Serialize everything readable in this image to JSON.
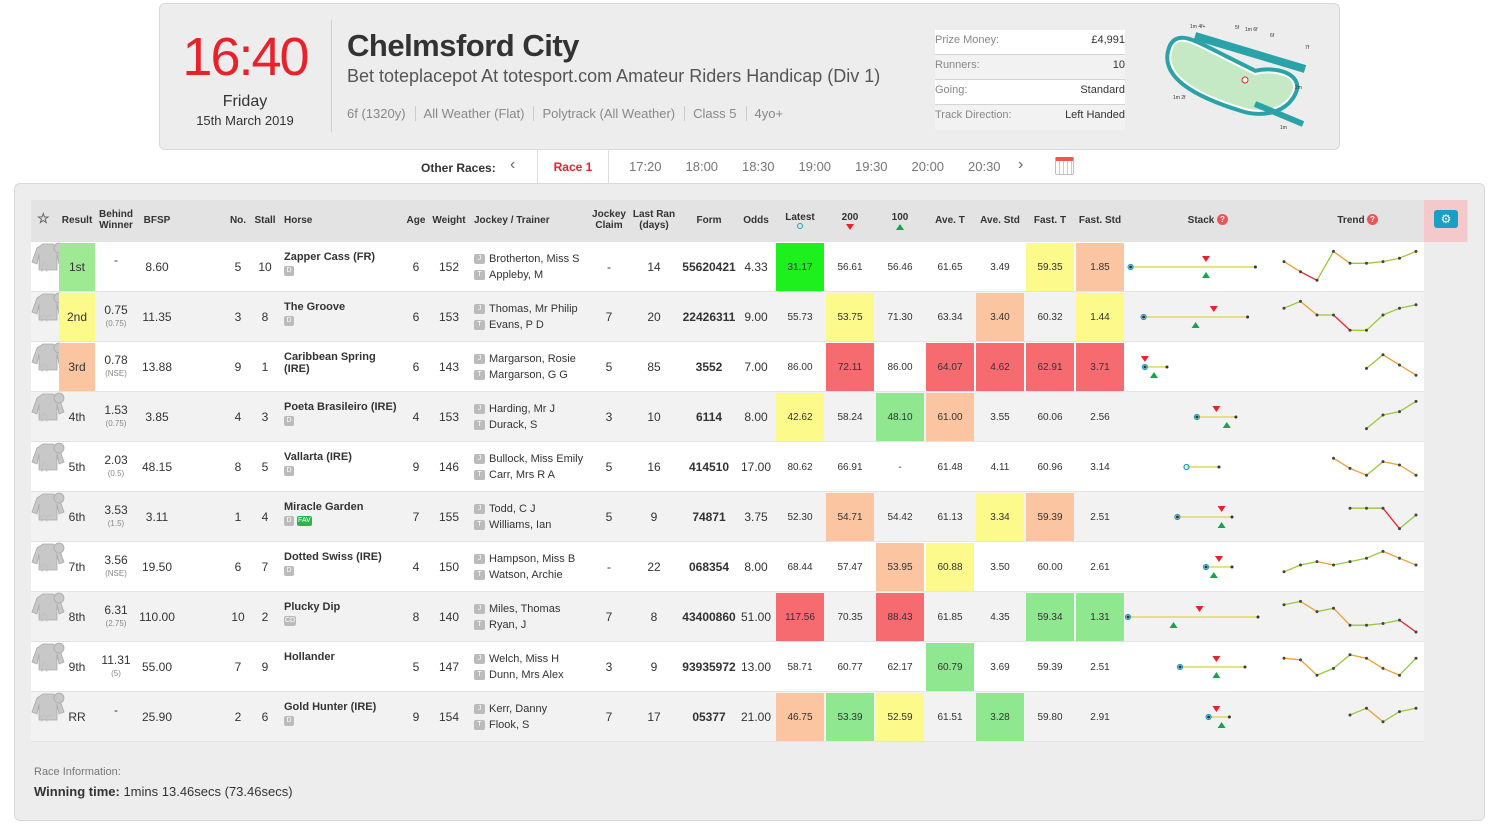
{
  "header": {
    "time": "16:40",
    "day": "Friday",
    "date": "15th March 2019",
    "venue": "Chelmsford City",
    "race_name": "Bet toteplacepot At totesport.com Amateur Riders Handicap (Div 1)",
    "meta": [
      "6f (1320y)",
      "All Weather (Flat)",
      "Polytrack (All Weather)",
      "Class 5",
      "4yo+"
    ],
    "info": [
      {
        "label": "Prize Money:",
        "value": "£4,991"
      },
      {
        "label": "Runners:",
        "value": "10"
      },
      {
        "label": "Going:",
        "value": "Standard"
      },
      {
        "label": "Track Direction:",
        "value": "Left Handed"
      }
    ],
    "track_labels": [
      "1m 4f+",
      "5f",
      "1m 6f",
      "6f",
      "7f",
      "1m 2f",
      "2m",
      "1m"
    ]
  },
  "nav": {
    "other_label": "Other Races:",
    "current": "Race 1",
    "times": [
      "17:20",
      "18:00",
      "18:30",
      "19:00",
      "19:30",
      "20:00",
      "20:30"
    ]
  },
  "columns": {
    "result": "Result",
    "behind": "Behind Winner",
    "bfsp": "BFSP",
    "no": "No.",
    "stall": "Stall",
    "horse": "Horse",
    "age": "Age",
    "weight": "Weight",
    "jockey": "Jockey / Trainer",
    "claim": "Jockey Claim",
    "lastran": "Last Ran (days)",
    "form": "Form",
    "odds": "Odds",
    "latest": "Latest",
    "c200": "200",
    "c100": "100",
    "avet": "Ave. T",
    "avestd": "Ave. Std",
    "fastt": "Fast. T",
    "faststd": "Fast. Std",
    "stack": "Stack",
    "trend": "Trend"
  },
  "colors": {
    "green": "#8fe88f",
    "bright_green": "#1ef01e",
    "yellow": "#fdfa8c",
    "orange": "#fbc5a2",
    "red": "#f66b6f",
    "win": "#9dea92"
  },
  "runners": [
    {
      "result": "1st",
      "resc": "#9dea92",
      "behind": "-",
      "behind_sub": "",
      "bfsp": "8.60",
      "no": "5",
      "stall": "10",
      "horse": "Zapper Cass (FR)",
      "tags": [
        "D"
      ],
      "age": "6",
      "weight": "152",
      "jockey": "Brotherton, Miss S",
      "trainer": "Appleby, M",
      "claim": "-",
      "lastran": "14",
      "form": "55620421",
      "odds": "4.33",
      "metrics": [
        [
          "31.17",
          "#1ef01e"
        ],
        [
          "56.61",
          ""
        ],
        [
          "56.46",
          ""
        ],
        [
          "61.65",
          ""
        ],
        [
          "3.49",
          ""
        ],
        [
          "59.35",
          "#fdfa8c"
        ],
        [
          "1.85",
          "#fbc5a2"
        ]
      ],
      "stack": [
        0.02,
        0.98,
        0.6,
        0.6
      ],
      "trend": [
        0.4,
        0.7,
        0.95,
        0.1,
        0.45,
        0.45,
        0.4,
        0.3,
        0.1
      ]
    },
    {
      "result": "2nd",
      "resc": "#fdfa8c",
      "behind": "0.75",
      "behind_sub": "(0.75)",
      "bfsp": "11.35",
      "no": "3",
      "stall": "8",
      "horse": "The Groove",
      "tags": [
        "D"
      ],
      "age": "6",
      "weight": "153",
      "jockey": "Thomas, Mr Philip",
      "trainer": "Evans, P D",
      "claim": "7",
      "lastran": "20",
      "form": "22426311",
      "odds": "9.00",
      "metrics": [
        [
          "55.73",
          ""
        ],
        [
          "53.75",
          "#fdfa8c"
        ],
        [
          "71.30",
          ""
        ],
        [
          "63.34",
          ""
        ],
        [
          "3.40",
          "#fbc5a2"
        ],
        [
          "60.32",
          ""
        ],
        [
          "1.44",
          "#fdfa8c"
        ]
      ],
      "stack": [
        0.12,
        0.92,
        0.66,
        0.52
      ],
      "trend": [
        0.3,
        0.1,
        0.5,
        0.5,
        0.95,
        0.95,
        0.5,
        0.3,
        0.2
      ]
    },
    {
      "result": "3rd",
      "resc": "#fbc5a2",
      "behind": "0.78",
      "behind_sub": "(NSE)",
      "bfsp": "13.88",
      "no": "9",
      "stall": "1",
      "horse": "Caribbean Spring (IRE)",
      "tags": [],
      "age": "6",
      "weight": "143",
      "jockey": "Margarson, Rosie",
      "trainer": "Margarson, G G",
      "claim": "5",
      "lastran": "85",
      "form": "3552",
      "odds": "7.00",
      "metrics": [
        [
          "86.00",
          ""
        ],
        [
          "72.11",
          "#f66b6f"
        ],
        [
          "86.00",
          ""
        ],
        [
          "64.07",
          "#f66b6f"
        ],
        [
          "4.62",
          "#f66b6f"
        ],
        [
          "62.91",
          "#f66b6f"
        ],
        [
          "3.71",
          "#f66b6f"
        ]
      ],
      "stack": [
        0.13,
        0.3,
        0.13,
        0.2
      ],
      "trend": [
        null,
        null,
        null,
        null,
        null,
        0.6,
        0.2,
        0.5,
        0.8
      ]
    },
    {
      "result": "4th",
      "resc": "",
      "behind": "1.53",
      "behind_sub": "(0.75)",
      "bfsp": "3.85",
      "no": "4",
      "stall": "3",
      "horse": "Poeta Brasileiro (IRE)",
      "tags": [
        "D"
      ],
      "age": "4",
      "weight": "153",
      "jockey": "Harding, Mr J",
      "trainer": "Durack, S",
      "claim": "3",
      "lastran": "10",
      "form": "6114",
      "odds": "8.00",
      "metrics": [
        [
          "42.62",
          "#fdfa8c"
        ],
        [
          "58.24",
          ""
        ],
        [
          "48.10",
          "#8fe88f"
        ],
        [
          "61.00",
          "#fbc5a2"
        ],
        [
          "3.55",
          ""
        ],
        [
          "60.06",
          ""
        ],
        [
          "2.56",
          ""
        ]
      ],
      "stack": [
        0.53,
        0.83,
        0.68,
        0.76
      ],
      "trend": [
        null,
        null,
        null,
        null,
        null,
        0.9,
        0.5,
        0.4,
        0.1
      ]
    },
    {
      "result": "5th",
      "resc": "",
      "behind": "2.03",
      "behind_sub": "(0.5)",
      "bfsp": "48.15",
      "no": "8",
      "stall": "5",
      "horse": "Vallarta (IRE)",
      "tags": [
        "D"
      ],
      "age": "9",
      "weight": "146",
      "jockey": "Bullock, Miss Emily",
      "trainer": "Carr, Mrs R A",
      "claim": "5",
      "lastran": "16",
      "form": "414510",
      "odds": "17.00",
      "metrics": [
        [
          "80.62",
          ""
        ],
        [
          "66.91",
          ""
        ],
        [
          "-",
          ""
        ],
        [
          "61.48",
          ""
        ],
        [
          "4.11",
          ""
        ],
        [
          "60.96",
          ""
        ],
        [
          "3.14",
          ""
        ]
      ],
      "stack": [
        0.45,
        0.7,
        null,
        null
      ],
      "trend": [
        null,
        null,
        null,
        0.3,
        0.6,
        0.8,
        0.4,
        0.5,
        0.8
      ]
    },
    {
      "result": "6th",
      "resc": "",
      "behind": "3.53",
      "behind_sub": "(1.5)",
      "bfsp": "3.11",
      "no": "1",
      "stall": "4",
      "horse": "Miracle Garden",
      "tags": [
        "D",
        "FAV"
      ],
      "age": "7",
      "weight": "155",
      "jockey": "Todd, C J",
      "trainer": "Williams, Ian",
      "claim": "5",
      "lastran": "9",
      "form": "74871",
      "odds": "3.75",
      "metrics": [
        [
          "52.30",
          ""
        ],
        [
          "54.71",
          "#fbc5a2"
        ],
        [
          "54.42",
          ""
        ],
        [
          "61.13",
          ""
        ],
        [
          "3.34",
          "#fdfa8c"
        ],
        [
          "59.39",
          "#fbc5a2"
        ],
        [
          "2.51",
          ""
        ]
      ],
      "stack": [
        0.38,
        0.8,
        0.72,
        0.72
      ],
      "trend": [
        null,
        null,
        null,
        null,
        0.3,
        0.3,
        0.3,
        0.9,
        0.5
      ]
    },
    {
      "result": "7th",
      "resc": "",
      "behind": "3.56",
      "behind_sub": "(NSE)",
      "bfsp": "19.50",
      "no": "6",
      "stall": "7",
      "horse": "Dotted Swiss (IRE)",
      "tags": [
        "D"
      ],
      "age": "4",
      "weight": "150",
      "jockey": "Hampson, Miss B",
      "trainer": "Watson, Archie",
      "claim": "-",
      "lastran": "22",
      "form": "068354",
      "odds": "8.00",
      "metrics": [
        [
          "68.44",
          ""
        ],
        [
          "57.47",
          ""
        ],
        [
          "53.95",
          "#fbc5a2"
        ],
        [
          "60.88",
          "#fdfa8c"
        ],
        [
          "3.50",
          ""
        ],
        [
          "60.00",
          ""
        ],
        [
          "2.61",
          ""
        ]
      ],
      "stack": [
        0.6,
        0.8,
        0.7,
        0.66
      ],
      "trend": [
        0.7,
        0.5,
        0.4,
        0.5,
        0.4,
        0.3,
        0.1,
        0.3,
        0.5
      ]
    },
    {
      "result": "8th",
      "resc": "",
      "behind": "6.31",
      "behind_sub": "(2.75)",
      "bfsp": "110.00",
      "no": "10",
      "stall": "2",
      "horse": "Plucky Dip",
      "tags": [
        "CD"
      ],
      "age": "8",
      "weight": "140",
      "jockey": "Miles, Thomas",
      "trainer": "Ryan, J",
      "claim": "7",
      "lastran": "8",
      "form": "43400860",
      "odds": "51.00",
      "metrics": [
        [
          "117.56",
          "#f66b6f"
        ],
        [
          "70.35",
          ""
        ],
        [
          "88.43",
          "#f66b6f"
        ],
        [
          "61.85",
          ""
        ],
        [
          "4.35",
          ""
        ],
        [
          "59.34",
          "#8fe88f"
        ],
        [
          "1.31",
          "#8fe88f"
        ]
      ],
      "stack": [
        0.0,
        1.0,
        0.55,
        0.35
      ],
      "trend": [
        0.2,
        0.1,
        0.4,
        0.3,
        0.8,
        0.8,
        0.75,
        0.65,
        1.0
      ]
    },
    {
      "result": "9th",
      "resc": "",
      "behind": "11.31",
      "behind_sub": "(5)",
      "bfsp": "55.00",
      "no": "7",
      "stall": "9",
      "horse": "Hollander",
      "tags": [],
      "age": "5",
      "weight": "147",
      "jockey": "Welch, Miss H",
      "trainer": "Dunn, Mrs Alex",
      "claim": "3",
      "lastran": "9",
      "form": "93935972",
      "odds": "13.00",
      "metrics": [
        [
          "58.71",
          ""
        ],
        [
          "60.77",
          ""
        ],
        [
          "62.17",
          ""
        ],
        [
          "60.79",
          "#8fe88f"
        ],
        [
          "3.69",
          ""
        ],
        [
          "59.39",
          ""
        ],
        [
          "2.51",
          ""
        ]
      ],
      "stack": [
        0.4,
        0.9,
        0.68,
        0.68
      ],
      "trend": [
        0.3,
        0.35,
        0.8,
        0.6,
        0.2,
        0.3,
        0.6,
        0.8,
        0.3
      ]
    },
    {
      "result": "RR",
      "resc": "",
      "behind": "-",
      "behind_sub": "",
      "bfsp": "25.90",
      "no": "2",
      "stall": "6",
      "horse": "Gold Hunter (IRE)",
      "tags": [
        "D"
      ],
      "age": "9",
      "weight": "154",
      "jockey": "Kerr, Danny",
      "trainer": "Flook, S",
      "claim": "7",
      "lastran": "17",
      "form": "05377",
      "odds": "21.00",
      "metrics": [
        [
          "46.75",
          "#fbc5a2"
        ],
        [
          "53.39",
          "#8fe88f"
        ],
        [
          "52.59",
          "#fdfa8c"
        ],
        [
          "61.51",
          ""
        ],
        [
          "3.28",
          "#8fe88f"
        ],
        [
          "59.80",
          ""
        ],
        [
          "2.91",
          ""
        ]
      ],
      "stack": [
        0.62,
        0.78,
        0.68,
        0.72
      ],
      "trend": [
        null,
        null,
        null,
        null,
        0.5,
        0.3,
        0.7,
        0.4,
        0.3
      ]
    }
  ],
  "footer": {
    "label": "Race Information:",
    "winning_label": "Winning time:",
    "winning_value": "1mins 13.46secs (73.46secs)"
  }
}
